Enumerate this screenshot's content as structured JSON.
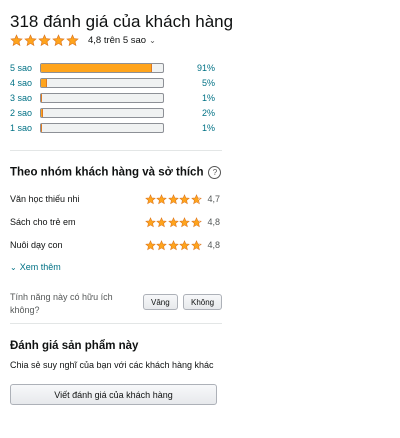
{
  "reviews": {
    "title": "318 đánh giá của khách hàng",
    "rating_summary": "4,8 trên 5 sao",
    "stars_filled": 5
  },
  "histogram": [
    {
      "label": "5 sao",
      "percent_text": "91%",
      "percent": 91
    },
    {
      "label": "4 sao",
      "percent_text": "5%",
      "percent": 5
    },
    {
      "label": "3 sao",
      "percent_text": "1%",
      "percent": 1
    },
    {
      "label": "2 sao",
      "percent_text": "2%",
      "percent": 2
    },
    {
      "label": "1 sao",
      "percent_text": "1%",
      "percent": 1
    }
  ],
  "groups": {
    "heading": "Theo nhóm khách hàng và sở thích",
    "help_icon": "?",
    "items": [
      {
        "label": "Văn học thiếu nhi",
        "value": "4,7",
        "stars": 4.7
      },
      {
        "label": "Sách cho trẻ em",
        "value": "4,8",
        "stars": 4.8
      },
      {
        "label": "Nuôi dạy con",
        "value": "4,8",
        "stars": 4.8
      }
    ],
    "see_more": "Xem thêm"
  },
  "helpful": {
    "question": "Tính năng này có hữu ích không?",
    "yes_label": "Vâng",
    "no_label": "Không"
  },
  "write_review": {
    "heading": "Đánh giá sản phẩm này",
    "description": "Chia sẻ suy nghĩ của bạn với các khách hàng khác",
    "button_label": "Viết đánh giá của khách hàng"
  },
  "colors": {
    "star": "#ffa41c",
    "star_stroke": "#de7921",
    "link": "#007185"
  }
}
